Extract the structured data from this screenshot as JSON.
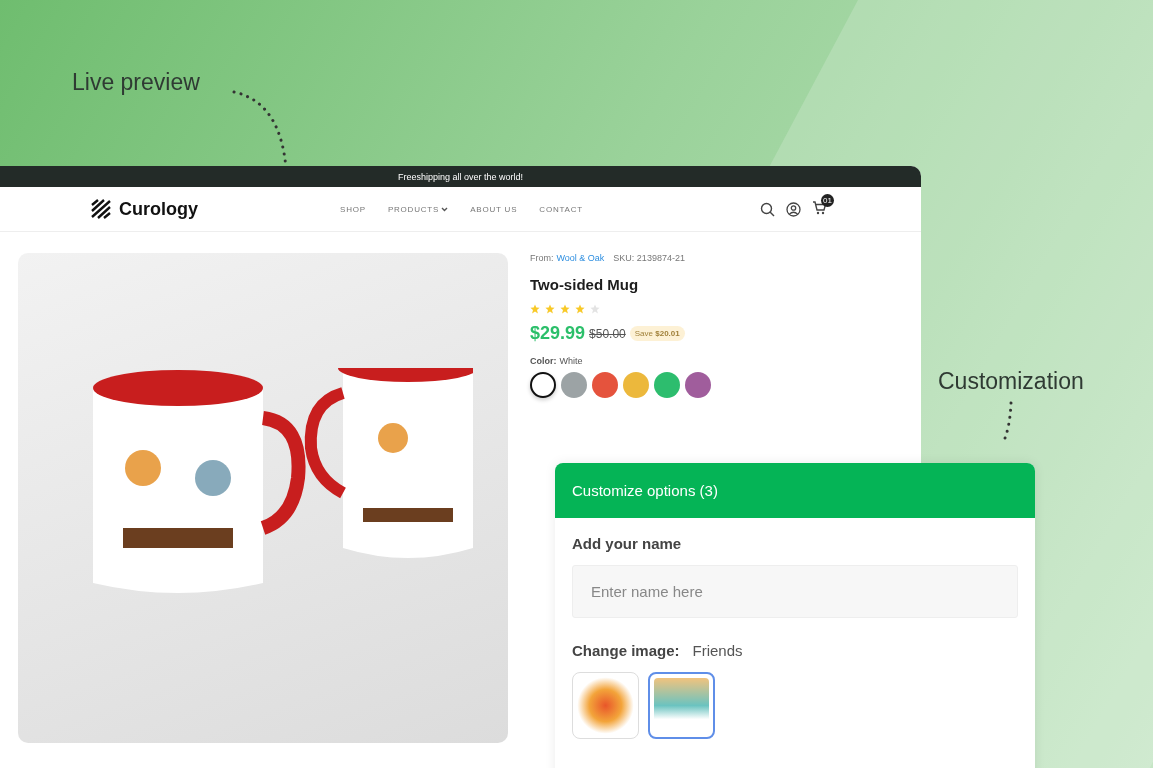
{
  "annotations": [
    {
      "text": "Live preview"
    },
    {
      "text": "Customization"
    }
  ],
  "top_banner": "Freeshipping all over the world!",
  "header": {
    "logo": "Curology",
    "nav": [
      {
        "label": "SHOP",
        "dropdown": false
      },
      {
        "label": "PRODUCTS",
        "dropdown": true
      },
      {
        "label": "ABOUT US",
        "dropdown": false
      },
      {
        "label": "CONTACT",
        "dropdown": false
      }
    ],
    "cart_count": "01"
  },
  "product": {
    "from_label": "From:",
    "vendor": "Wool & Oak",
    "sku": "SKU: 2139874-21",
    "title": "Two-sided Mug",
    "stars": 4,
    "price": "$29.99",
    "old_price": "$50.00",
    "save": "Save **$20.01**",
    "color_label": "Color:",
    "color_value": "White",
    "swatches": [
      {
        "color": "#ffffff",
        "selected": true
      },
      {
        "color": "#9ca3a5",
        "selected": false
      },
      {
        "color": "#e5533d",
        "selected": false
      },
      {
        "color": "#ecb83c",
        "selected": false
      },
      {
        "color": "#2dbd6e",
        "selected": false
      },
      {
        "color": "#a05d9c",
        "selected": false
      }
    ]
  },
  "customize": {
    "title": "Customize options (3)",
    "name_label": "Add your name",
    "name_placeholder": "Enter name here",
    "image_label": "Change image:",
    "image_value": "Friends",
    "images": [
      {
        "selected": false
      },
      {
        "selected": true
      }
    ]
  }
}
